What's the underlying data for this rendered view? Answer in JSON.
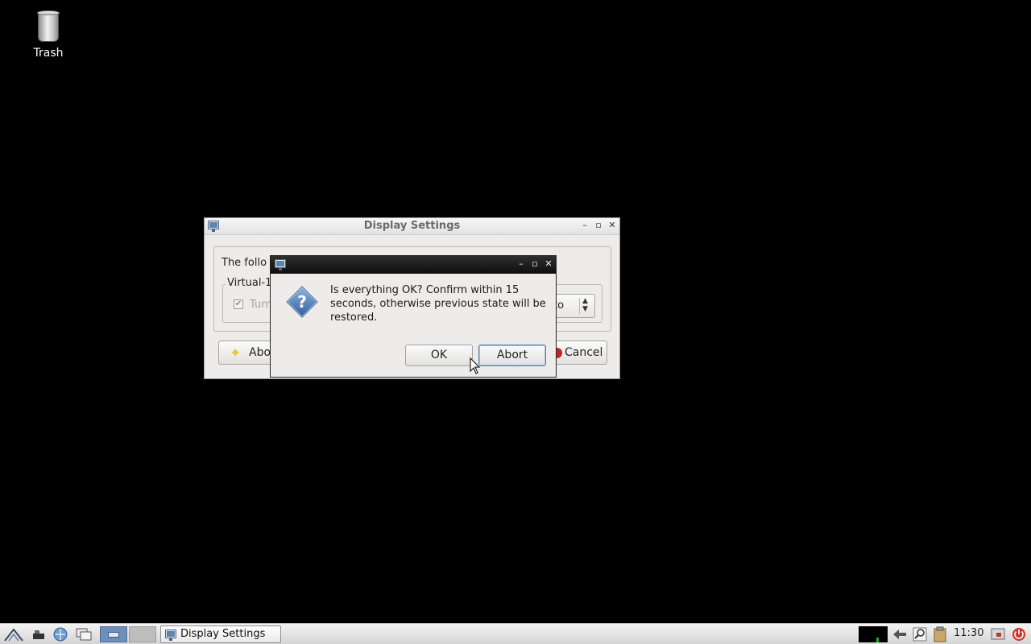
{
  "desktop": {
    "icons": [
      {
        "label": "Trash",
        "icon": "trash-icon"
      }
    ]
  },
  "display_settings": {
    "title": "Display Settings",
    "message": "The follo",
    "output_group": "Virtual-1",
    "turn_on_label": "Turn",
    "turn_on_checked": true,
    "resolution_value": "to",
    "about_label": "Abou",
    "cancel_label": "Cancel"
  },
  "confirm_dialog": {
    "message": "Is everything OK? Confirm within 15 seconds, otherwise previous state will be restored.",
    "ok_label": "OK",
    "abort_label": "Abort",
    "icon": "question-icon"
  },
  "taskbar": {
    "tasks": [
      {
        "label": "Display Settings",
        "active": true
      }
    ],
    "clock": "11:30"
  },
  "colors": {
    "desktop_bg": "#000000",
    "dialog_titlebar": "#1a1a1a",
    "window_bg": "#edeceb",
    "power_icon": "#d0342c"
  }
}
